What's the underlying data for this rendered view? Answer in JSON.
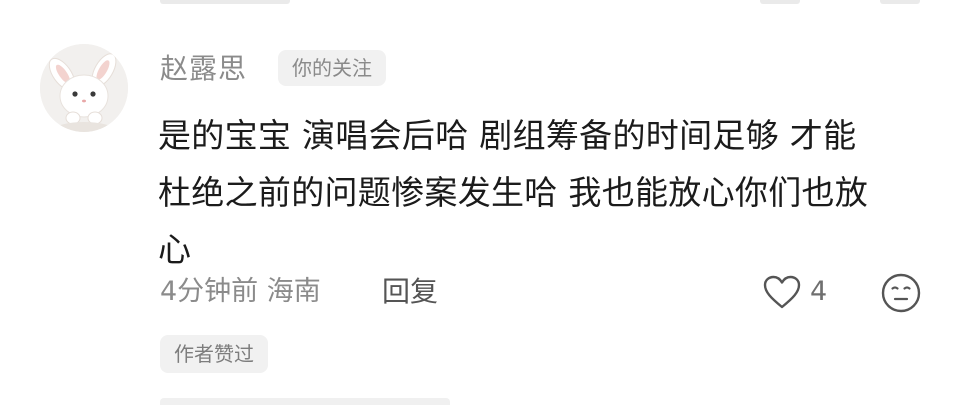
{
  "comment": {
    "username": "赵露思",
    "follow_badge": "你的关注",
    "text": "是的宝宝 演唱会后哈 剧组筹备的时间足够 才能\n杜绝之前的问题惨案发生哈 我也能放心你们也放\n心",
    "time": "4分钟前",
    "location": "海南",
    "reply_label": "回复",
    "like_count": "4",
    "author_liked": "作者赞过"
  },
  "icons": {
    "avatar": "bunny-avatar",
    "like": "heart-icon",
    "emoji": "neutral-face-icon"
  },
  "colors": {
    "meta_gray": "#8b8b8b",
    "badge_bg": "#f1f1f1",
    "text_dark": "#1b1b1b"
  }
}
